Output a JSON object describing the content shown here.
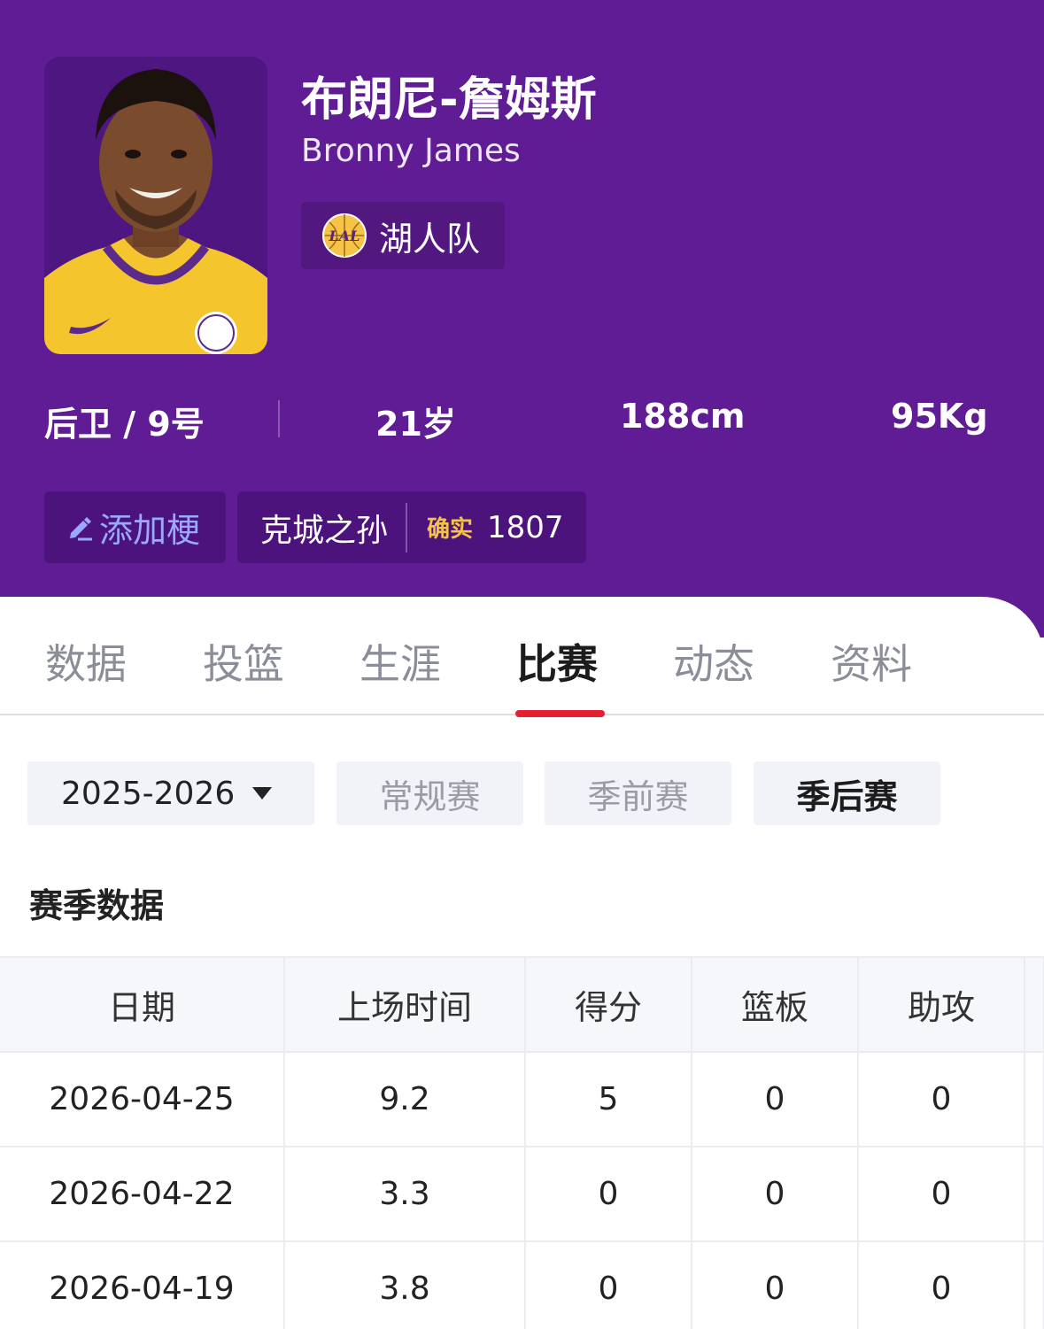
{
  "player": {
    "name_cn": "布朗尼-詹姆斯",
    "name_en": "Bronny James",
    "team": "湖人队",
    "team_logo_text": "LAL",
    "position_number": "后卫 / 9号",
    "age": "21岁",
    "height": "188cm",
    "weight": "95Kg"
  },
  "meme": {
    "add_label": "添加梗",
    "tag_text": "克城之孙",
    "confirm_badge": "确实",
    "confirm_count": "1807"
  },
  "tabs": [
    "数据",
    "投篮",
    "生涯",
    "比赛",
    "动态",
    "资料"
  ],
  "active_tab": "比赛",
  "filters": {
    "season": "2025-2026",
    "types": [
      "常规赛",
      "季前赛",
      "季后赛"
    ],
    "active_type": "季后赛"
  },
  "section_title": "赛季数据",
  "table": {
    "headers": [
      "日期",
      "上场时间",
      "得分",
      "篮板",
      "助攻"
    ],
    "rows": [
      [
        "2026-04-25",
        "9.2",
        "5",
        "0",
        "0"
      ],
      [
        "2026-04-22",
        "3.3",
        "0",
        "0",
        "0"
      ],
      [
        "2026-04-19",
        "3.8",
        "0",
        "0",
        "0"
      ]
    ]
  },
  "colors": {
    "header_purple": "#5f1c95",
    "accent_red": "#e5202e",
    "confirm_gold": "#f6c347",
    "jersey_gold": "#f5c52e"
  }
}
